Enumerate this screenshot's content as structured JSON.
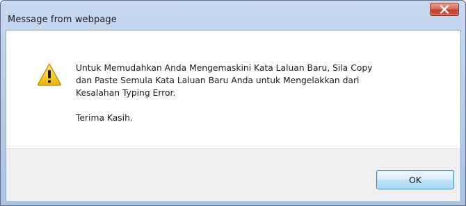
{
  "window": {
    "title": "Message from webpage"
  },
  "dialog": {
    "message_lines": [
      "Untuk Memudahkan Anda Mengemaskini Kata Laluan Baru, Sila Copy",
      "dan Paste Semula Kata Laluan Baru Anda untuk Mengelakkan dari",
      "Kesalahan Typing Error."
    ],
    "closing": "Terima Kasih.",
    "icon": "warning-icon"
  },
  "buttons": {
    "ok_label": "OK",
    "close_icon": "close-icon"
  },
  "colors": {
    "titlebar": "#b9cfea",
    "close_button": "#c0422a",
    "footer": "#efefef",
    "ok_button_border": "#3c7fb1",
    "warning_fill": "#f4c20d"
  }
}
